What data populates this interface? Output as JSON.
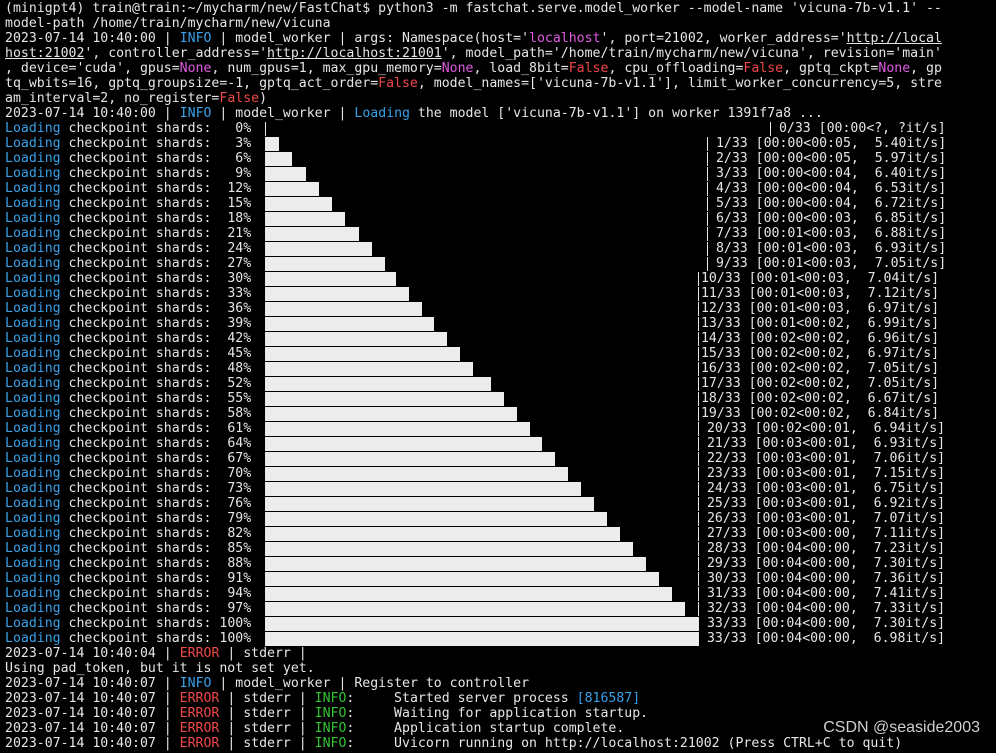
{
  "header": {
    "line1": "(minigpt4) train@train:~/mycharm/new/FastChat$ python3 -m fastchat.serve.model_worker --model-name 'vicuna-7b-v1.1' --",
    "line2": "model-path /home/train/mycharm/new/vicuna"
  },
  "args_log": {
    "ts": "2023-07-14 10:40:00",
    "level": "INFO",
    "l1a": " | model_worker | args: Namespace(host='",
    "host": "localhost",
    "l1b": "', port=21002, worker_address='",
    "url1": "http://local",
    "url2": "host:21002",
    "l2a": "', controller_address='",
    "url3": "http://localhost:21001",
    "l2b": "', model_path='/home/train/mycharm/new/vicuna', revision='main'",
    "l3a": ", device='cuda', gpus=",
    "none": "None",
    "l3b": ", num_gpus=1, max_gpu_memory=",
    "l3c": ", load_8bit=",
    "false": "False",
    "l3d": ", cpu_offloading=",
    "l3e": ", gptq_ckpt=",
    "l3f": ", gp",
    "l4a": "tq_wbits=16, gptq_groupsize=-1, gptq_act_order=",
    "l4b": ", model_names=['vicuna-7b-v1.1'], limit_worker_concurrency=5, stre",
    "l5a": "am_interval=2, no_register=",
    "l5b": ")"
  },
  "load_log": {
    "ts": "2023-07-14 10:40:00",
    "level": "INFO",
    "mid": " | model_worker | ",
    "loading": "Loading",
    "rest": " the model ['vicuna-7b-v1.1'] on worker 1391f7a8 ..."
  },
  "progress": {
    "loading_word": "Loading",
    "label": " checkpoint shards:",
    "rows": [
      {
        "pct": "0%",
        "frac": 0,
        "right": " 0/33 [00:00<?, ?it/s]"
      },
      {
        "pct": "3%",
        "frac": 0.03,
        "right": " 1/33 [00:00<00:05,  5.40it/s]"
      },
      {
        "pct": "6%",
        "frac": 0.06,
        "right": " 2/33 [00:00<00:05,  5.97it/s]"
      },
      {
        "pct": "9%",
        "frac": 0.09,
        "right": " 3/33 [00:00<00:04,  6.40it/s]"
      },
      {
        "pct": "12%",
        "frac": 0.12,
        "right": " 4/33 [00:00<00:04,  6.53it/s]"
      },
      {
        "pct": "15%",
        "frac": 0.15,
        "right": " 5/33 [00:00<00:04,  6.72it/s]"
      },
      {
        "pct": "18%",
        "frac": 0.18,
        "right": " 6/33 [00:00<00:03,  6.85it/s]"
      },
      {
        "pct": "21%",
        "frac": 0.21,
        "right": " 7/33 [00:01<00:03,  6.88it/s]"
      },
      {
        "pct": "24%",
        "frac": 0.24,
        "right": " 8/33 [00:01<00:03,  6.93it/s]"
      },
      {
        "pct": "27%",
        "frac": 0.27,
        "right": " 9/33 [00:01<00:03,  7.05it/s]"
      },
      {
        "pct": "30%",
        "frac": 0.3,
        "right": " 10/33 [00:01<00:03,  7.04it/s]"
      },
      {
        "pct": "33%",
        "frac": 0.33,
        "right": " 11/33 [00:01<00:03,  7.12it/s]"
      },
      {
        "pct": "36%",
        "frac": 0.36,
        "right": " 12/33 [00:01<00:03,  6.97it/s]"
      },
      {
        "pct": "39%",
        "frac": 0.39,
        "right": " 13/33 [00:01<00:02,  6.99it/s]"
      },
      {
        "pct": "42%",
        "frac": 0.42,
        "right": " 14/33 [00:02<00:02,  6.96it/s]"
      },
      {
        "pct": "45%",
        "frac": 0.45,
        "right": " 15/33 [00:02<00:02,  6.97it/s]"
      },
      {
        "pct": "48%",
        "frac": 0.48,
        "right": " 16/33 [00:02<00:02,  7.05it/s]"
      },
      {
        "pct": "52%",
        "frac": 0.52,
        "right": " 17/33 [00:02<00:02,  7.05it/s]"
      },
      {
        "pct": "55%",
        "frac": 0.55,
        "right": " 18/33 [00:02<00:02,  6.67it/s]"
      },
      {
        "pct": "58%",
        "frac": 0.58,
        "right": " 19/33 [00:02<00:02,  6.84it/s]"
      },
      {
        "pct": "61%",
        "frac": 0.61,
        "right": " 20/33 [00:02<00:01,  6.94it/s]"
      },
      {
        "pct": "64%",
        "frac": 0.64,
        "right": " 21/33 [00:03<00:01,  6.93it/s]"
      },
      {
        "pct": "67%",
        "frac": 0.67,
        "right": " 22/33 [00:03<00:01,  7.06it/s]"
      },
      {
        "pct": "70%",
        "frac": 0.7,
        "right": " 23/33 [00:03<00:01,  7.15it/s]"
      },
      {
        "pct": "73%",
        "frac": 0.73,
        "right": " 24/33 [00:03<00:01,  6.75it/s]"
      },
      {
        "pct": "76%",
        "frac": 0.76,
        "right": " 25/33 [00:03<00:01,  6.92it/s]"
      },
      {
        "pct": "79%",
        "frac": 0.79,
        "right": " 26/33 [00:03<00:01,  7.07it/s]"
      },
      {
        "pct": "82%",
        "frac": 0.82,
        "right": " 27/33 [00:03<00:00,  7.11it/s]"
      },
      {
        "pct": "85%",
        "frac": 0.85,
        "right": " 28/33 [00:04<00:00,  7.23it/s]"
      },
      {
        "pct": "88%",
        "frac": 0.88,
        "right": " 29/33 [00:04<00:00,  7.30it/s]"
      },
      {
        "pct": "91%",
        "frac": 0.91,
        "right": " 30/33 [00:04<00:00,  7.36it/s]"
      },
      {
        "pct": "94%",
        "frac": 0.94,
        "right": " 31/33 [00:04<00:00,  7.41it/s]"
      },
      {
        "pct": "97%",
        "frac": 0.97,
        "right": " 32/33 [00:04<00:00,  7.33it/s]"
      },
      {
        "pct": "100%",
        "frac": 1.0,
        "right": " 33/33 [00:04<00:00,  7.30it/s]"
      },
      {
        "pct": "100%",
        "frac": 1.0,
        "right": " 33/33 [00:04<00:00,  6.98it/s]"
      }
    ]
  },
  "tail": {
    "err1": {
      "ts": "2023-07-14 10:40:04",
      "level": "ERROR",
      "rest": " | stderr |"
    },
    "pad": "Using pad_token, but it is not set yet.",
    "reg": {
      "ts": "2023-07-14 10:40:07",
      "level": "INFO",
      "rest": " | model_worker | Register to controller"
    },
    "stderr_lines": [
      {
        "ts": "2023-07-14 10:40:07",
        "level": "ERROR",
        "mid": " | stderr | ",
        "info": "INFO",
        "msg": ":     Started server process ",
        "pid": "[816587]"
      },
      {
        "ts": "2023-07-14 10:40:07",
        "level": "ERROR",
        "mid": " | stderr | ",
        "info": "INFO",
        "msg": ":     Waiting for application startup.",
        "pid": ""
      },
      {
        "ts": "2023-07-14 10:40:07",
        "level": "ERROR",
        "mid": " | stderr | ",
        "info": "INFO",
        "msg": ":     Application startup complete.",
        "pid": ""
      },
      {
        "ts": "2023-07-14 10:40:07",
        "level": "ERROR",
        "mid": " | stderr | ",
        "info": "INFO",
        "msg": ":     Uvicorn running on http://localhost:21002 (Press CTRL+C to quit)",
        "pid": ""
      }
    ]
  },
  "watermark": "CSDN @seaside2003"
}
